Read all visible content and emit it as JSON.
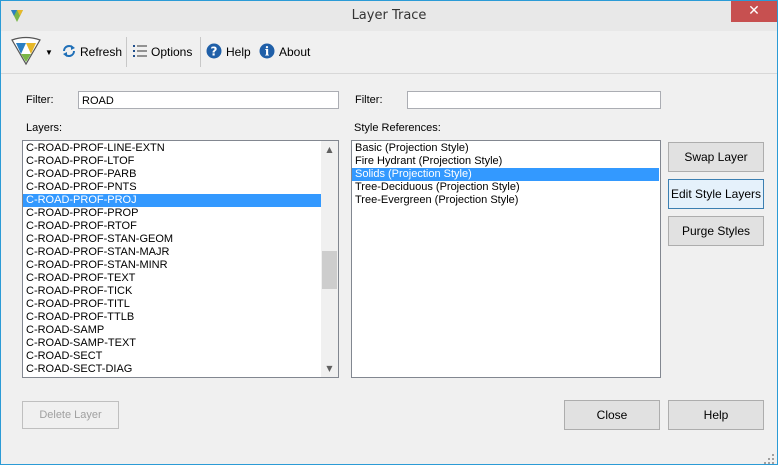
{
  "window": {
    "title": "Layer Trace",
    "close_glyph": "✕"
  },
  "toolbar": {
    "app_menu_icon": "app-logo-icon",
    "refresh_label": "Refresh",
    "options_label": "Options",
    "help_label": "Help",
    "about_label": "About"
  },
  "left": {
    "filter_label": "Filter:",
    "filter_value": "ROAD",
    "list_label": "Layers:",
    "items": [
      "C-ROAD-PROF-LINE-EXTN",
      "C-ROAD-PROF-LTOF",
      "C-ROAD-PROF-PARB",
      "C-ROAD-PROF-PNTS",
      "C-ROAD-PROF-PROJ",
      "C-ROAD-PROF-PROP",
      "C-ROAD-PROF-RTOF",
      "C-ROAD-PROF-STAN-GEOM",
      "C-ROAD-PROF-STAN-MAJR",
      "C-ROAD-PROF-STAN-MINR",
      "C-ROAD-PROF-TEXT",
      "C-ROAD-PROF-TICK",
      "C-ROAD-PROF-TITL",
      "C-ROAD-PROF-TTLB",
      "C-ROAD-SAMP",
      "C-ROAD-SAMP-TEXT",
      "C-ROAD-SECT",
      "C-ROAD-SECT-DIAG"
    ],
    "selected_item": "C-ROAD-PROF-PROJ"
  },
  "right": {
    "filter_label": "Filter:",
    "filter_value": "",
    "list_label": "Style References:",
    "items": [
      "Basic (Projection Style)",
      "Fire Hydrant (Projection Style)",
      "Solids (Projection Style)",
      "Tree-Deciduous (Projection Style)",
      "Tree-Evergreen (Projection Style)"
    ],
    "selected_item": "Solids (Projection Style)"
  },
  "buttons": {
    "swap_layer": "Swap Layer",
    "edit_style_layers": "Edit Style Layers",
    "purge_styles": "Purge Styles",
    "delete_layer": "Delete Layer",
    "close": "Close",
    "help": "Help"
  },
  "colors": {
    "selection": "#3399ff",
    "close_button": "#c75050",
    "window_border": "#2b9bd6"
  }
}
